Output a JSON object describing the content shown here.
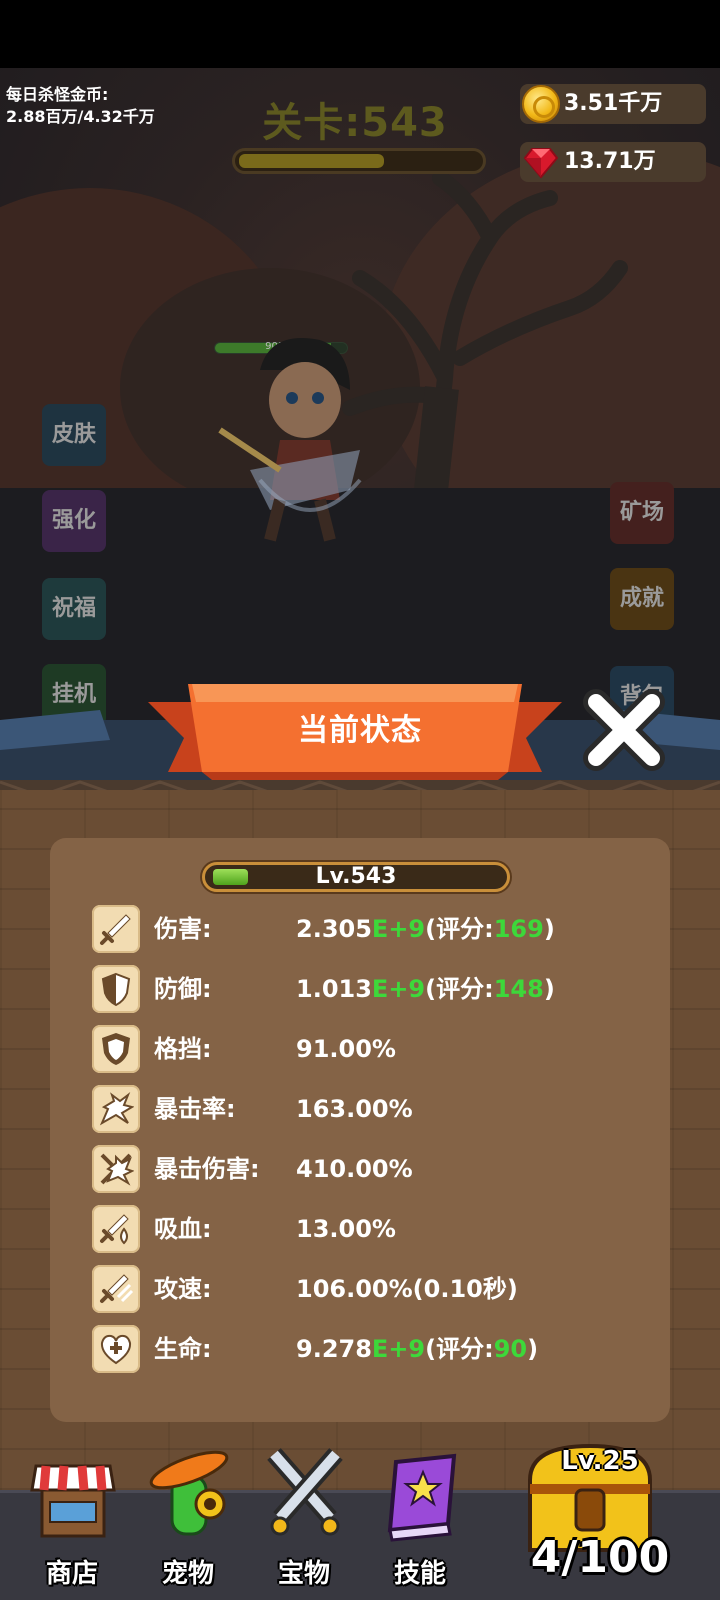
{
  "hud": {
    "daily_kill_label": "每日杀怪金币:",
    "daily_kill_value": "2.88百万/4.32千万",
    "stage_title": "关卡:543",
    "stage_progress": 0.6,
    "gold": "3.51千万",
    "gems": "13.71万",
    "hero_hp_text": "90176",
    "hero_hp_fraction": 0.88
  },
  "side_buttons": {
    "left": [
      "皮肤",
      "强化",
      "祝福",
      "挂机"
    ],
    "right": [
      "矿场",
      "成就",
      "背包"
    ]
  },
  "dialog": {
    "title": "当前状态",
    "level_text": "Lv.543",
    "level_progress": 0.12,
    "stats": [
      {
        "icon": "sword-icon",
        "label": "伤害:",
        "value": "2.305",
        "exp": "E+9",
        "pre": "(评分:",
        "score": "169",
        "post": ")"
      },
      {
        "icon": "shield-icon",
        "label": "防御:",
        "value": "1.013",
        "exp": "E+9",
        "pre": "(评分:",
        "score": "148",
        "post": ")"
      },
      {
        "icon": "block-shield-icon",
        "label": "格挡:",
        "value": "91.00%"
      },
      {
        "icon": "crit-burst-icon",
        "label": "暴击率:",
        "value": "163.00%"
      },
      {
        "icon": "crit-damage-icon",
        "label": "暴击伤害:",
        "value": "410.00%"
      },
      {
        "icon": "lifesteal-icon",
        "label": "吸血:",
        "value": "13.00%"
      },
      {
        "icon": "attack-speed-icon",
        "label": "攻速:",
        "value": "106.00%(0.10秒)"
      },
      {
        "icon": "heart-plus-icon",
        "label": "生命:",
        "value": "9.278",
        "exp": "E+9",
        "pre": "(评分:",
        "score": "90",
        "post": ")"
      }
    ]
  },
  "bottom_nav": {
    "items": [
      {
        "label": "商店",
        "icon": "shop-stall-icon"
      },
      {
        "label": "宠物",
        "icon": "pet-cactus-icon"
      },
      {
        "label": "宝物",
        "icon": "crossed-swords-icon"
      },
      {
        "label": "技能",
        "icon": "skill-book-icon"
      }
    ],
    "chest_level": "Lv.25",
    "chest_count": "4/100"
  },
  "colors": {
    "accent_orange": "#f46a2a",
    "score_green": "#3dd83a",
    "panel_brown": "#846346"
  }
}
